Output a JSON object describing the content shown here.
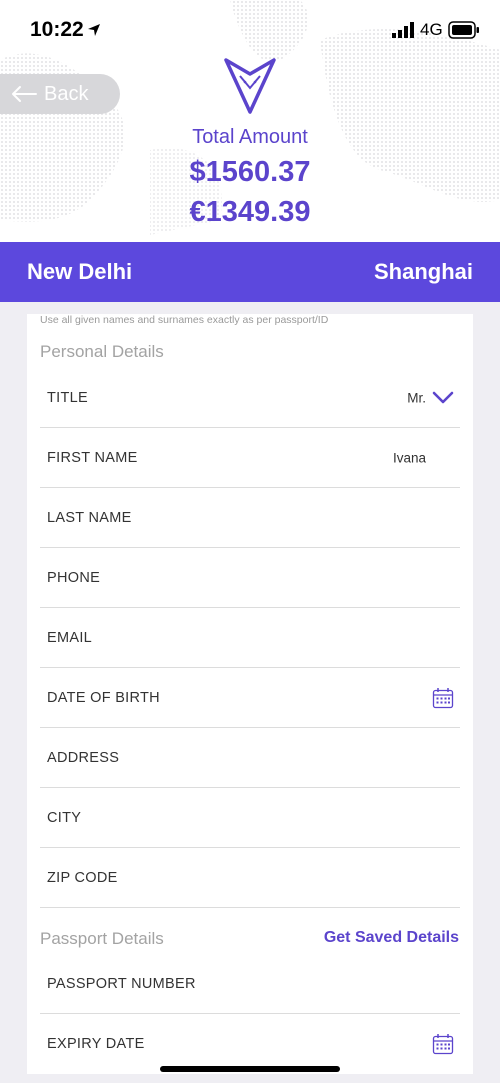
{
  "status_bar": {
    "time": "10:22",
    "network": "4G"
  },
  "back_button": {
    "label": "Back"
  },
  "summary": {
    "total_label": "Total Amount",
    "amount_usd": "$1560.37",
    "amount_eur": "€1349.39"
  },
  "route": {
    "from": "New Delhi",
    "to": "Shanghai"
  },
  "form": {
    "hint": "Use all given names and surnames exactly as per passport/ID",
    "personal_title": "Personal Details",
    "title_field": {
      "label": "TITLE",
      "value": "Mr."
    },
    "first_name": {
      "label": "FIRST NAME",
      "value": "Ivana"
    },
    "last_name": {
      "label": "LAST NAME"
    },
    "phone": {
      "label": "PHONE"
    },
    "email": {
      "label": "EMAIL"
    },
    "dob": {
      "label": "DATE OF BIRTH"
    },
    "address": {
      "label": "ADDRESS"
    },
    "city": {
      "label": "CITY"
    },
    "zip": {
      "label": "ZIP CODE"
    },
    "passport_title": "Passport Details",
    "saved_link": "Get Saved Details",
    "passport_number": {
      "label": "PASSPORT NUMBER"
    },
    "expiry_date": {
      "label": "EXPIRY DATE"
    }
  },
  "icons": {
    "location": "location-arrow-icon",
    "signal": "signal-icon",
    "battery": "battery-icon",
    "back": "arrow-left-icon",
    "logo": "fox-logo-icon",
    "dropdown": "chevron-down-icon",
    "calendar": "calendar-icon"
  },
  "colors": {
    "accent": "#5c48dd",
    "text_accent": "#5b44cc",
    "background": "#efeef3"
  }
}
